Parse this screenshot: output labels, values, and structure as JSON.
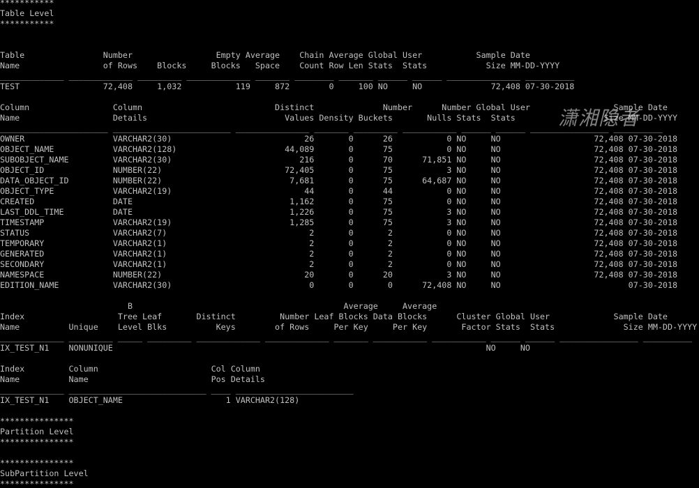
{
  "terminal": {
    "background": "#000000",
    "foreground": "#c0c0c0",
    "lines": [
      "***********",
      "Table Level",
      "***********",
      "",
      "",
      "Table                Number                 Empty Average    Chain Average Global User           Sample Date",
      "Name                 of Rows    Blocks     Blocks   Space    Count Row Len Stats  Stats            Size MM-DD-YYYY",
      "_____________ _____________ _________ _____________ _______ ________ _______ ______ ______ _______________ __________",
      "TEST                 72,408     1,032           119     872        0     100 NO     NO              72,408 07-30-2018",
      "",
      "Column                 Column                           Distinct              Number      Number Global User                 Sample Date",
      "Name                   Details                            Values Density Buckets       Nulls Stats  Stats                  Size MM-DD-YYYY",
      "______________________ ________________________ _______________ _______ _________ ___________ ______ ______ ________________ __________",
      "OWNER                  VARCHAR2(30)                           26       0      26           0 NO     NO                   72,408 07-30-2018",
      "OBJECT_NAME            VARCHAR2(128)                      44,089       0      75           0 NO     NO                   72,408 07-30-2018",
      "SUBOBJECT_NAME         VARCHAR2(30)                          216       0      70      71,851 NO     NO                   72,408 07-30-2018",
      "OBJECT_ID              NUMBER(22)                         72,405       0      75           3 NO     NO                   72,408 07-30-2018",
      "DATA_OBJECT_ID         NUMBER(22)                          7,681       0      75      64,687 NO     NO                   72,408 07-30-2018",
      "OBJECT_TYPE            VARCHAR2(19)                           44       0      44           0 NO     NO                   72,408 07-30-2018",
      "CREATED                DATE                                1,162       0      75           0 NO     NO                   72,408 07-30-2018",
      "LAST_DDL_TIME          DATE                                1,226       0      75           3 NO     NO                   72,408 07-30-2018",
      "TIMESTAMP              VARCHAR2(19)                        1,285       0      75           3 NO     NO                   72,408 07-30-2018",
      "STATUS                 VARCHAR2(7)                             2       0       2           0 NO     NO                   72,408 07-30-2018",
      "TEMPORARY              VARCHAR2(1)                             2       0       2           0 NO     NO                   72,408 07-30-2018",
      "GENERATED              VARCHAR2(1)                             2       0       2           0 NO     NO                   72,408 07-30-2018",
      "SECONDARY              VARCHAR2(1)                             2       0       2           0 NO     NO                   72,408 07-30-2018",
      "NAMESPACE              NUMBER(22)                             20       0      20           3 NO     NO                   72,408 07-30-2018",
      "EDITION_NAME           VARCHAR2(30)                            0       0       0      72,408 NO     NO                          07-30-2018",
      "",
      "                          B                                           Average     Average",
      "Index                   Tree Leaf       Distinct         Number Leaf Blocks Data Blocks      Cluster Global User             Sample Date",
      "Name          Unique    Level Blks          Keys        of Rows     Per Key     Per Key       Factor Stats  Stats              Size MM-DD-YYYY",
      "_____________ _________ _____ _________ _____________ _____________ _______ ___________ ___________ ______ ______ ________________ __________",
      "IX_TEST_N1    NONUNIQUE                                                                            NO     NO",
      "",
      "Index         Column                       Col Column",
      "Name          Name                         Pos Details",
      "_____________ ____________________________ ____ ________________________",
      "IX_TEST_N1    OBJECT_NAME                     1 VARCHAR2(128)",
      "",
      "***************",
      "Partition Level",
      "***************",
      "",
      "***************",
      "SubPartition Level",
      "***************"
    ],
    "watermark": "潇湘隐者"
  }
}
